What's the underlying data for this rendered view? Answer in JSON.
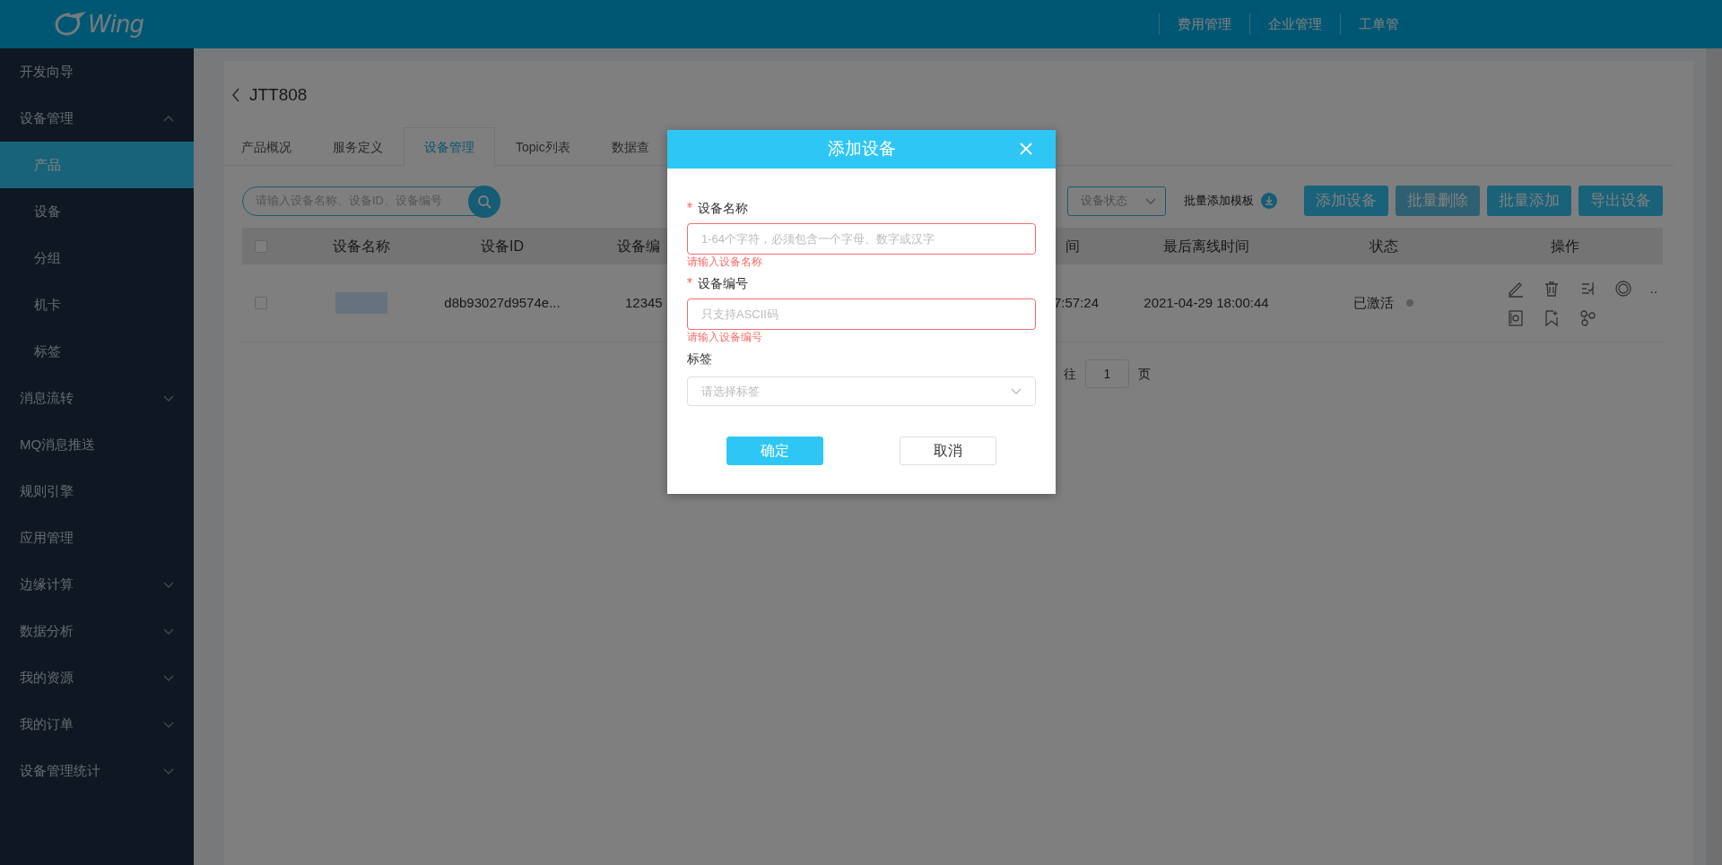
{
  "header": {
    "logo_text": "Wing",
    "nav": [
      "费用管理",
      "企业管理",
      "工单管"
    ]
  },
  "sidebar": {
    "items": [
      {
        "label": "开发向导",
        "kind": "link"
      },
      {
        "label": "设备管理",
        "kind": "group",
        "expanded": true,
        "children": [
          {
            "label": "产品",
            "selected": true
          },
          {
            "label": "设备",
            "selected": false
          },
          {
            "label": "分组",
            "selected": false
          },
          {
            "label": "机卡",
            "selected": false
          },
          {
            "label": "标签",
            "selected": false
          }
        ]
      },
      {
        "label": "消息流转",
        "kind": "group",
        "expanded": false
      },
      {
        "label": "MQ消息推送",
        "kind": "link"
      },
      {
        "label": "规则引擎",
        "kind": "link"
      },
      {
        "label": "应用管理",
        "kind": "link"
      },
      {
        "label": "边缘计算",
        "kind": "group",
        "expanded": false
      },
      {
        "label": "数据分析",
        "kind": "group",
        "expanded": false
      },
      {
        "label": "我的资源",
        "kind": "group",
        "expanded": false
      },
      {
        "label": "我的订单",
        "kind": "group",
        "expanded": false
      },
      {
        "label": "设备管理统计",
        "kind": "group",
        "expanded": false
      }
    ]
  },
  "page": {
    "title": "JTT808",
    "tabs": [
      {
        "label": "产品概况",
        "selected": false
      },
      {
        "label": "服务定义",
        "selected": false
      },
      {
        "label": "设备管理",
        "selected": true
      },
      {
        "label": "Topic列表",
        "selected": false
      },
      {
        "label": "数据查",
        "selected": false
      }
    ],
    "search": {
      "placeholder": "请输入设备名称、设备ID、设备编号"
    },
    "status_filter": {
      "placeholder": "设备状态"
    },
    "template_link": "批量添加模板",
    "buttons": [
      {
        "label": "添加设备",
        "disabled": false
      },
      {
        "label": "批量删除",
        "disabled": true
      },
      {
        "label": "批量添加",
        "disabled": false
      },
      {
        "label": "导出设备",
        "disabled": false
      }
    ],
    "table": {
      "header_checkbox": {
        "checked": false
      },
      "columns": [
        "设备名称",
        "设备ID",
        "设备编",
        "间",
        "最后离线时间",
        "状态",
        "操作"
      ],
      "rows": [
        {
          "checked": false,
          "device_id": "d8b93027d9574e...",
          "device_number": "12345",
          "column_5": "7:57:24",
          "last_offline": "2021-04-29 18:00:44",
          "status": "已激活",
          "more": ".."
        }
      ]
    },
    "pagination": {
      "goto_label": "往",
      "page": "1",
      "page_suffix": "页"
    }
  },
  "modal": {
    "title": "添加设备",
    "fields": [
      {
        "label": "设备名称",
        "required": true,
        "kind": "input",
        "placeholder": "1-64个字符，必须包含一个字母、数字或汉字",
        "error": "请输入设备名称"
      },
      {
        "label": "设备编号",
        "required": true,
        "kind": "input",
        "placeholder": "只支持ASCII码",
        "error": "请输入设备编号"
      },
      {
        "label": "标签",
        "required": false,
        "kind": "select",
        "placeholder": "请选择标签"
      }
    ],
    "buttons": [
      {
        "label": "确定",
        "primary": true
      },
      {
        "label": "取消",
        "primary": false
      }
    ]
  }
}
